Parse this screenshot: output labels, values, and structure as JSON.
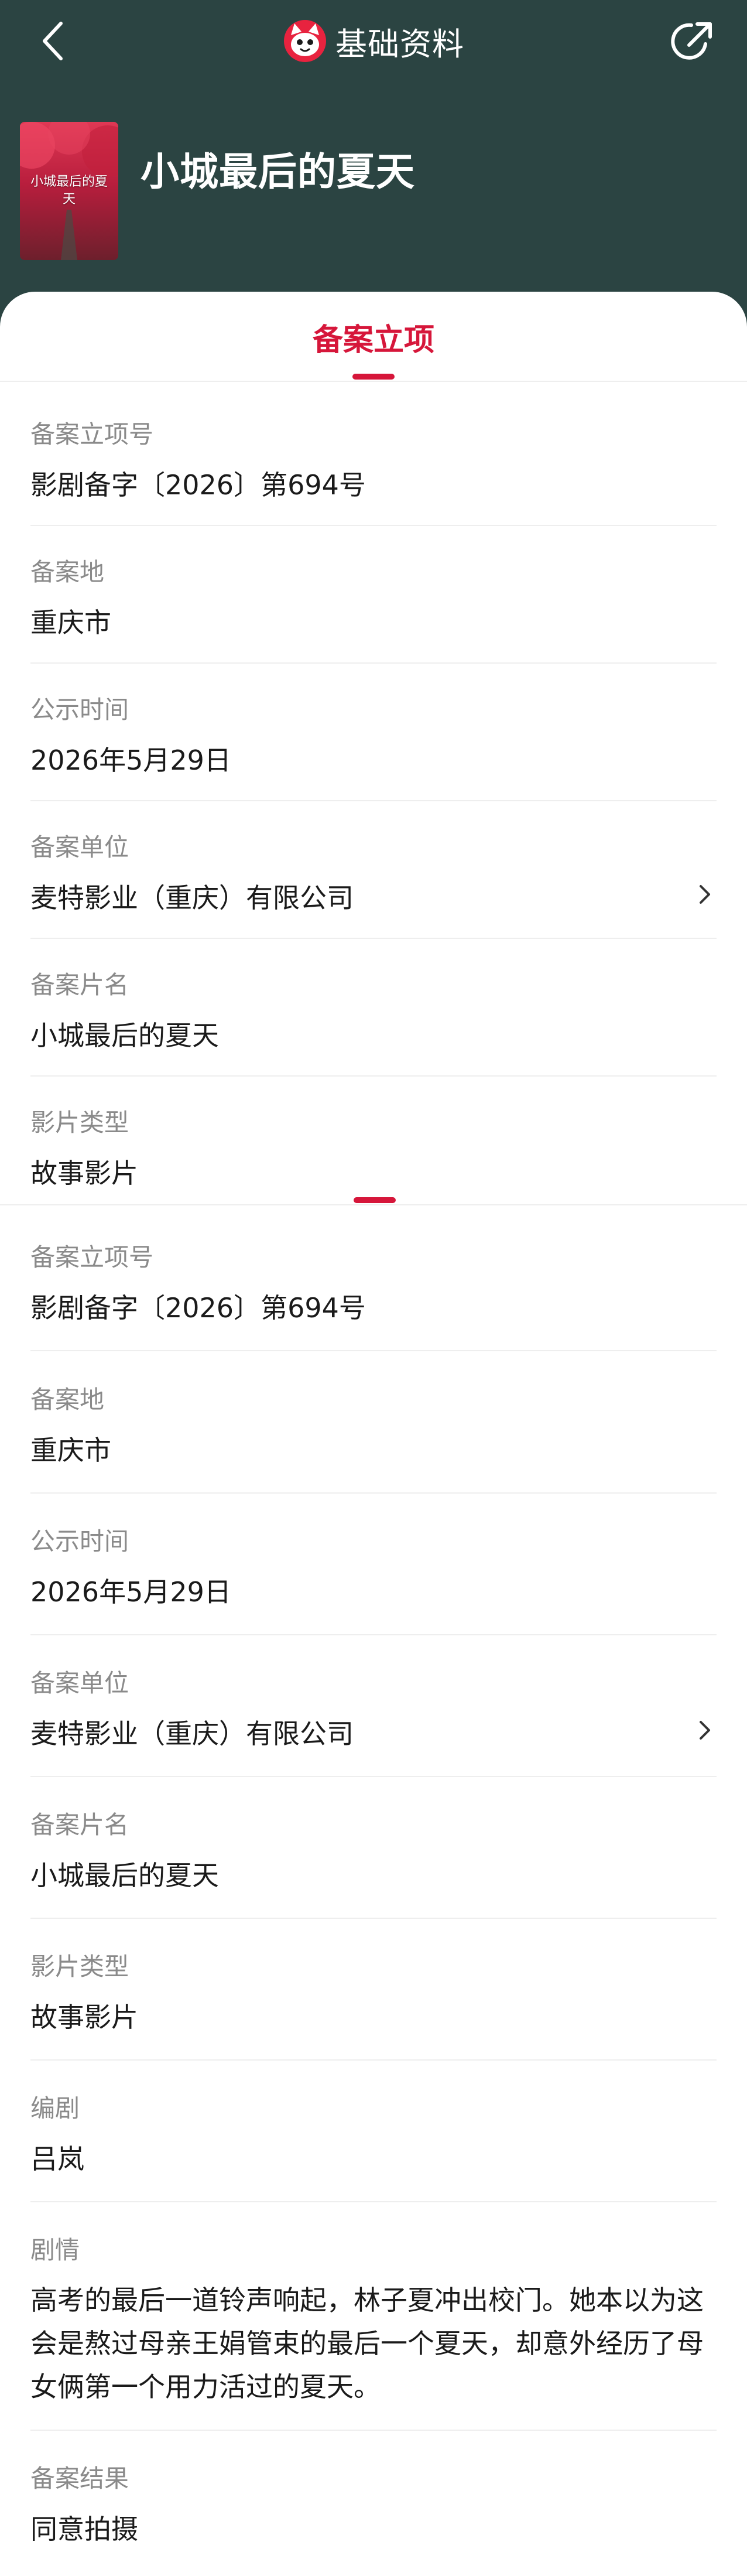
{
  "nav": {
    "title": "基础资料",
    "back_icon": "chevron-left-icon",
    "share_icon": "share-icon",
    "logo_icon": "cat-logo-icon"
  },
  "movie": {
    "title": "小城最后的夏天",
    "poster_text": "小城最后的夏天"
  },
  "tab": {
    "label": "备案立项"
  },
  "colors": {
    "header_bg": "#2b4442",
    "accent": "#d6163a",
    "label": "#8a8a8a",
    "divider": "#eeeeee"
  },
  "sections": [
    {
      "fields": [
        {
          "label": "备案立项号",
          "value": "影剧备字〔2026〕第694号"
        },
        {
          "label": "备案地",
          "value": "重庆市"
        },
        {
          "label": "公示时间",
          "value": "2026年5月29日"
        },
        {
          "label": "备案单位",
          "value": "麦特影业（重庆）有限公司",
          "has_chevron": true
        },
        {
          "label": "备案片名",
          "value": "小城最后的夏天"
        },
        {
          "label": "影片类型",
          "value": "故事影片"
        }
      ]
    },
    {
      "fields": [
        {
          "label": "备案立项号",
          "value": "影剧备字〔2026〕第694号"
        },
        {
          "label": "备案地",
          "value": "重庆市"
        },
        {
          "label": "公示时间",
          "value": "2026年5月29日"
        },
        {
          "label": "备案单位",
          "value": "麦特影业（重庆）有限公司",
          "has_chevron": true
        },
        {
          "label": "备案片名",
          "value": "小城最后的夏天"
        },
        {
          "label": "影片类型",
          "value": "故事影片"
        },
        {
          "label": "编剧",
          "value": "吕岚"
        },
        {
          "label": "剧情",
          "value": "高考的最后一道铃声响起，林子夏冲出校门。她本以为这会是熬过母亲王娟管束的最后一个夏天，却意外经历了母女俩第一个用力活过的夏天。"
        },
        {
          "label": "备案结果",
          "value": "同意拍摄"
        }
      ]
    }
  ]
}
